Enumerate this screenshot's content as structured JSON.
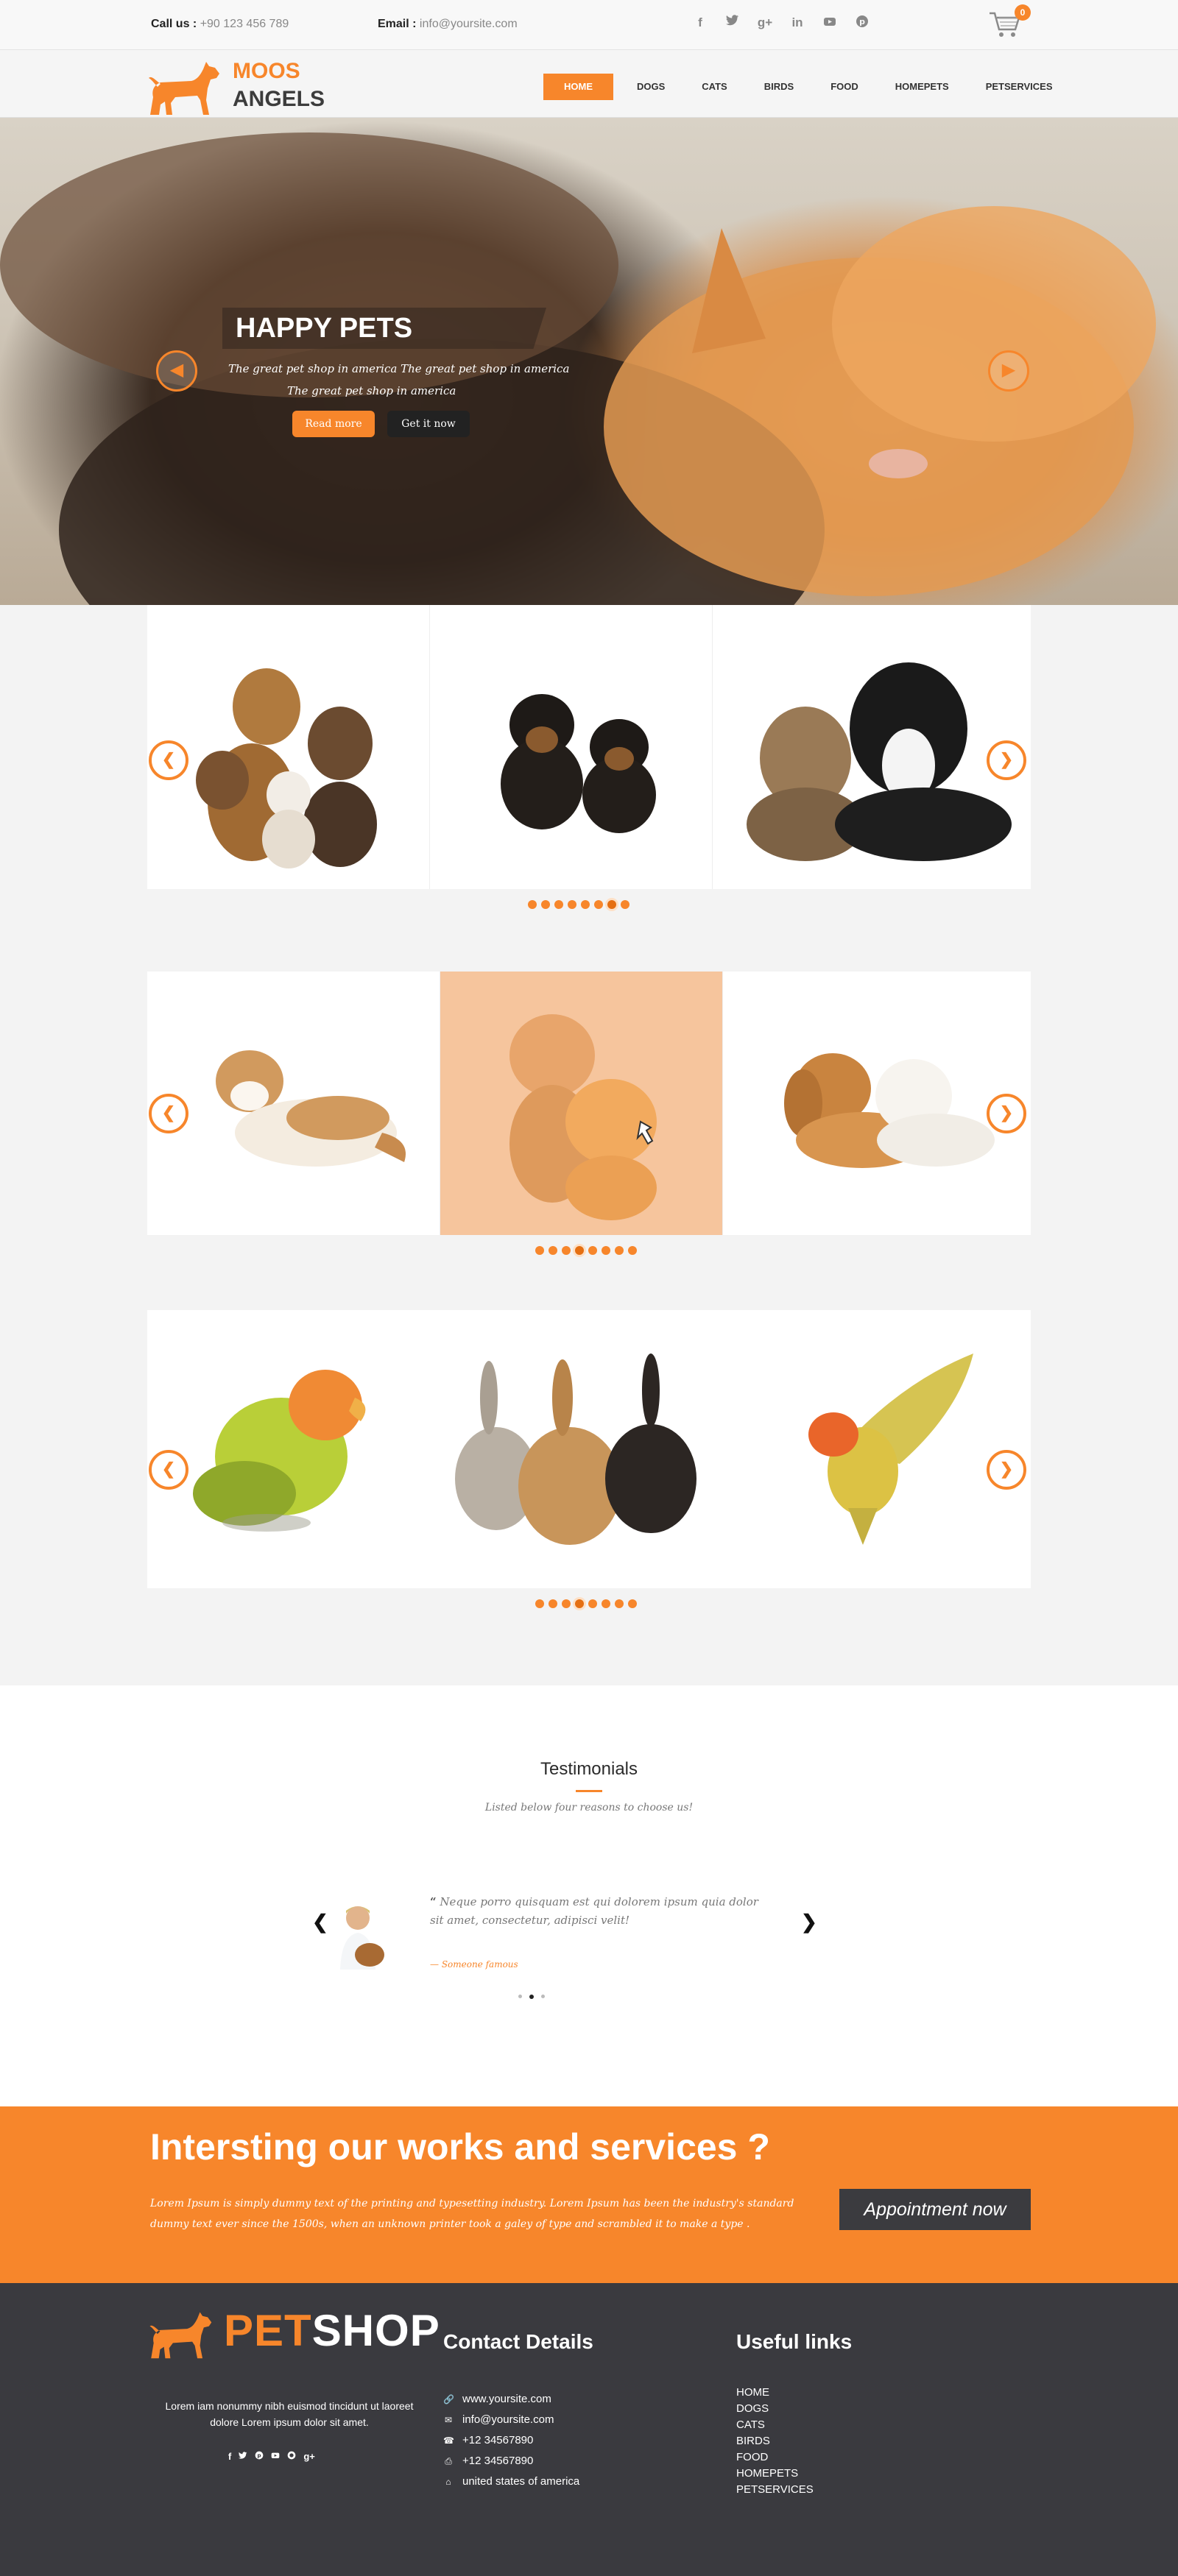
{
  "topbar": {
    "call_label": "Call us :",
    "call_value": "+90  123 456 789",
    "email_label": "Email :",
    "email_value": "info@yoursite.com",
    "socials": [
      "f",
      "t",
      "g+",
      "in",
      "yt",
      "p"
    ],
    "cart_count": "0"
  },
  "brand": {
    "line1": "MOOS",
    "line2": "ANGELS"
  },
  "nav": {
    "items": [
      "HOME",
      "DOGS",
      "CATS",
      "BIRDS",
      "FOOD",
      "HOMEPETS",
      "PETSERVICES"
    ],
    "active": "HOME"
  },
  "hero": {
    "title": "HAPPY PETS",
    "line1": "The great pet shop in america  The great pet shop in america",
    "line2": "The great pet shop in america",
    "read_more": "Read more",
    "get_it_now": "Get it now"
  },
  "carousels": [
    {
      "name": "dogs",
      "items": [
        "group of dogs",
        "rottweiler puppies",
        "cat and border collie"
      ],
      "dot_count": 8,
      "active_dot": 7
    },
    {
      "name": "cats",
      "items": [
        "fluffy cat",
        "two kittens",
        "puppy and kitten"
      ],
      "dot_count": 8,
      "active_dot": 4
    },
    {
      "name": "birds-rabbits",
      "items": [
        "lovebird",
        "three rabbits",
        "flying lovebird"
      ],
      "dot_count": 8,
      "active_dot": 4
    }
  ],
  "testimonials": {
    "title": "Testimonials",
    "subtitle": "Listed below four reasons to choose us!",
    "quote_mark": "“",
    "quote": "Neque porro quisquam est qui dolorem ipsum quia dolor sit amet, consectetur, adipisci velit!",
    "author": "— Someone famous",
    "dot_count": 3,
    "active_dot": 2
  },
  "cta": {
    "title": "Intersting  our works and services ?",
    "text": "Lorem Ipsum is simply dummy text of the printing and typesetting industry. Lorem Ipsum has been the industry's standard dummy text ever since the 1500s, when an unknown printer took a galey of type and scrambled it to make a type .",
    "button": "Appointment now"
  },
  "footer": {
    "logo_pet": "PET",
    "logo_shop": "SHOP",
    "about": "Lorem iam nonummy nibh euismod tincidunt ut laoreet dolore Lorem ipsum dolor sit amet.",
    "socials": [
      "f",
      "t",
      "p",
      "yt",
      "gh",
      "g+"
    ],
    "contact_title": "Contact Details",
    "contacts": [
      {
        "icon": "link-icon",
        "text": "www.yoursite.com"
      },
      {
        "icon": "envelope-icon",
        "text": "info@yoursite.com"
      },
      {
        "icon": "phone-icon",
        "text": "+12 34567890"
      },
      {
        "icon": "fax-icon",
        "text": "+12 34567890"
      },
      {
        "icon": "home-icon",
        "text": "united states of america"
      }
    ],
    "links_title": "Useful links",
    "links": [
      "HOME",
      "DOGS",
      "CATS",
      "BIRDS",
      "FOOD",
      "HOMEPETS",
      "PETSERVICES"
    ]
  },
  "colors": {
    "accent": "#f7862b",
    "dark": "#3a3a3f"
  }
}
